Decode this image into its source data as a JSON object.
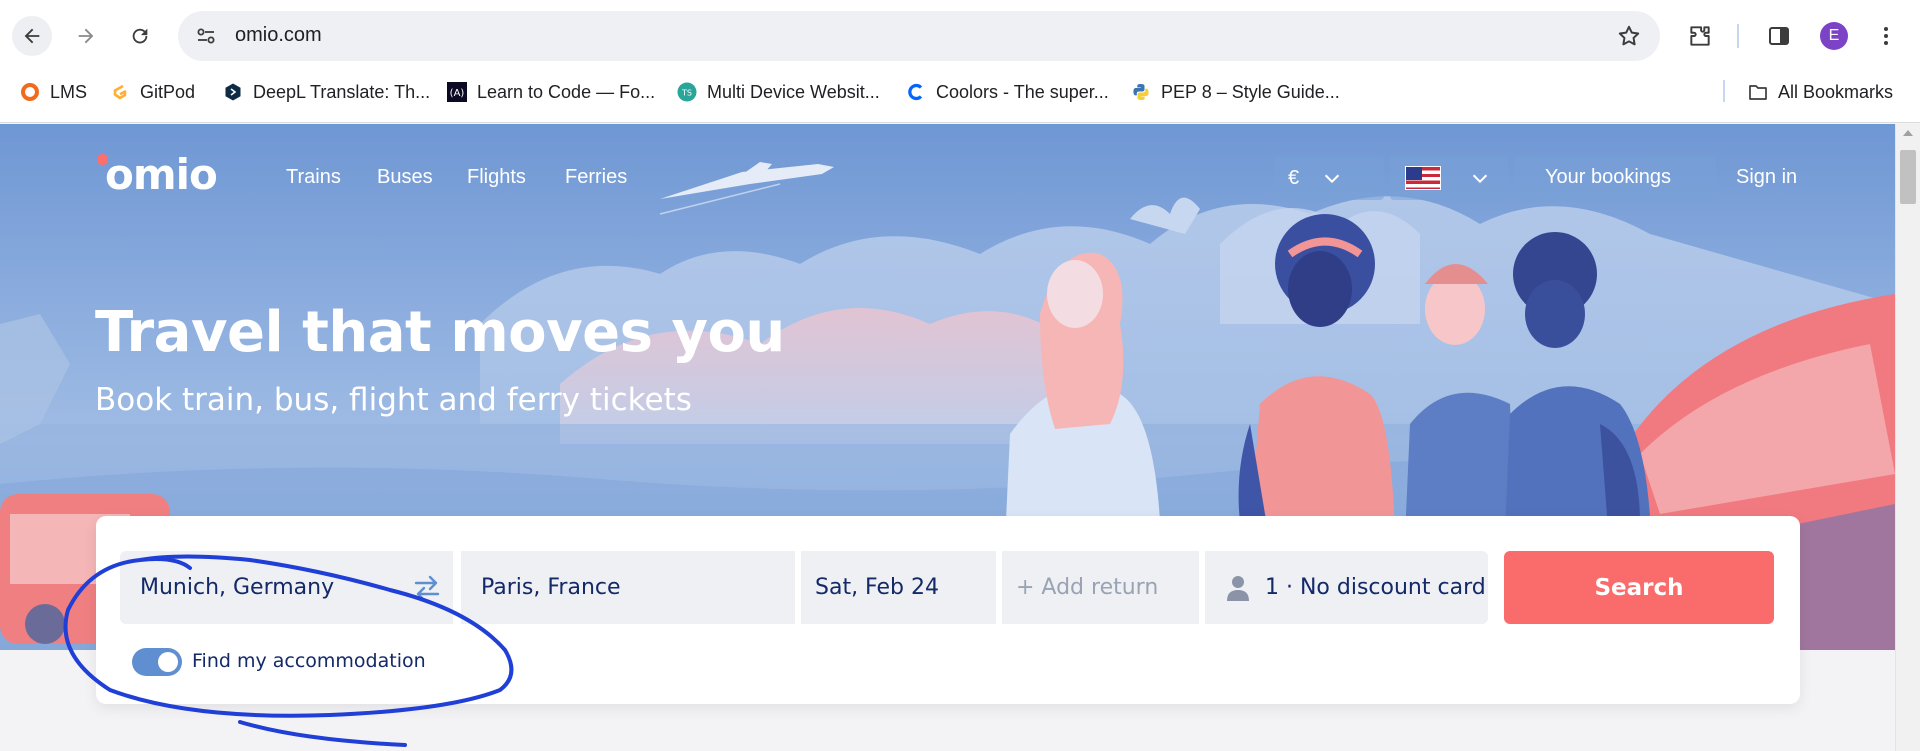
{
  "browser": {
    "url": "omio.com",
    "profile_initial": "E",
    "bookmarks": [
      {
        "label": "LMS",
        "icon": "lms-icon"
      },
      {
        "label": "GitPod",
        "icon": "gitpod-icon"
      },
      {
        "label": "DeepL Translate: Th...",
        "icon": "deepl-icon"
      },
      {
        "label": "Learn to Code — Fo...",
        "icon": "freecodecamp-icon"
      },
      {
        "label": "Multi Device Websit...",
        "icon": "ts-icon"
      },
      {
        "label": "Coolors - The super...",
        "icon": "coolors-icon"
      },
      {
        "label": "PEP 8 – Style Guide...",
        "icon": "python-icon"
      }
    ],
    "all_bookmarks": "All Bookmarks"
  },
  "header": {
    "logo": "omio",
    "nav": [
      "Trains",
      "Buses",
      "Flights",
      "Ferries"
    ],
    "currency": "€",
    "bookings": "Your bookings",
    "signin": "Sign in"
  },
  "hero": {
    "title": "Travel that moves you",
    "subtitle": "Book train, bus, flight and ferry tickets"
  },
  "search": {
    "from": "Munich, Germany",
    "to": "Paris, France",
    "date": "Sat, Feb 24",
    "return_placeholder": "+ Add return",
    "passengers": "1 · No discount card",
    "button": "Search",
    "accommodation_label": "Find my accommodation",
    "accommodation_on": true
  },
  "colors": {
    "brand_red": "#fa6b6b",
    "navy_text": "#132968",
    "toggle_blue": "#5f8fd0",
    "annotation_blue": "#1f3fd6"
  }
}
